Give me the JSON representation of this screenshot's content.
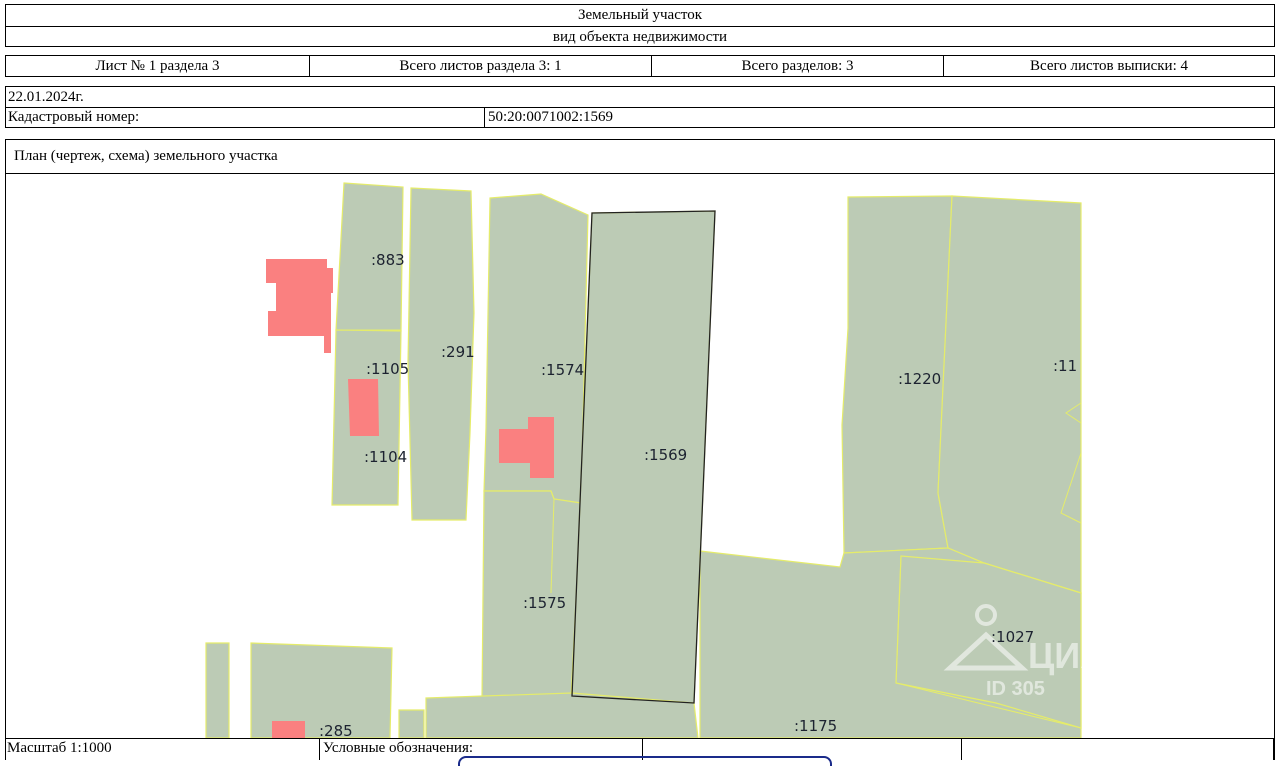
{
  "header": {
    "title": "Земельный участок",
    "subtitle": "вид объекта недвижимости"
  },
  "sheet_info": {
    "sheet": "Лист № 1 раздела 3",
    "total_sheets_section": "Всего листов раздела 3: 1",
    "total_sections": "Всего разделов: 3",
    "total_sheets_extract": "Всего листов выписки: 4"
  },
  "date": "22.01.2024г.",
  "cadastral": {
    "label": "Кадастровый номер:",
    "value": "50:20:0071002:1569"
  },
  "plan": {
    "title": "План (чертеж, схема) земельного участка",
    "labels": {
      "p883": ":883",
      "p1105": ":1105",
      "p291": ":291",
      "p1574": ":1574",
      "p1104": ":1104",
      "p1569": ":1569",
      "p1220": ":1220",
      "p11": ":11",
      "p1575": ":1575",
      "p1027": ":1027",
      "p285": ":285",
      "p1175": ":1175"
    },
    "watermark": {
      "brand": "ЦИАН",
      "id": "ID 305"
    },
    "colors": {
      "plot_fill": "#bccbb5",
      "plot_border": "#e5ec6a",
      "building": "#fa8080",
      "selected_border": "#222222"
    }
  },
  "footer": {
    "scale": "Масштаб 1:1000",
    "legend_label": "Условные обозначения:"
  }
}
